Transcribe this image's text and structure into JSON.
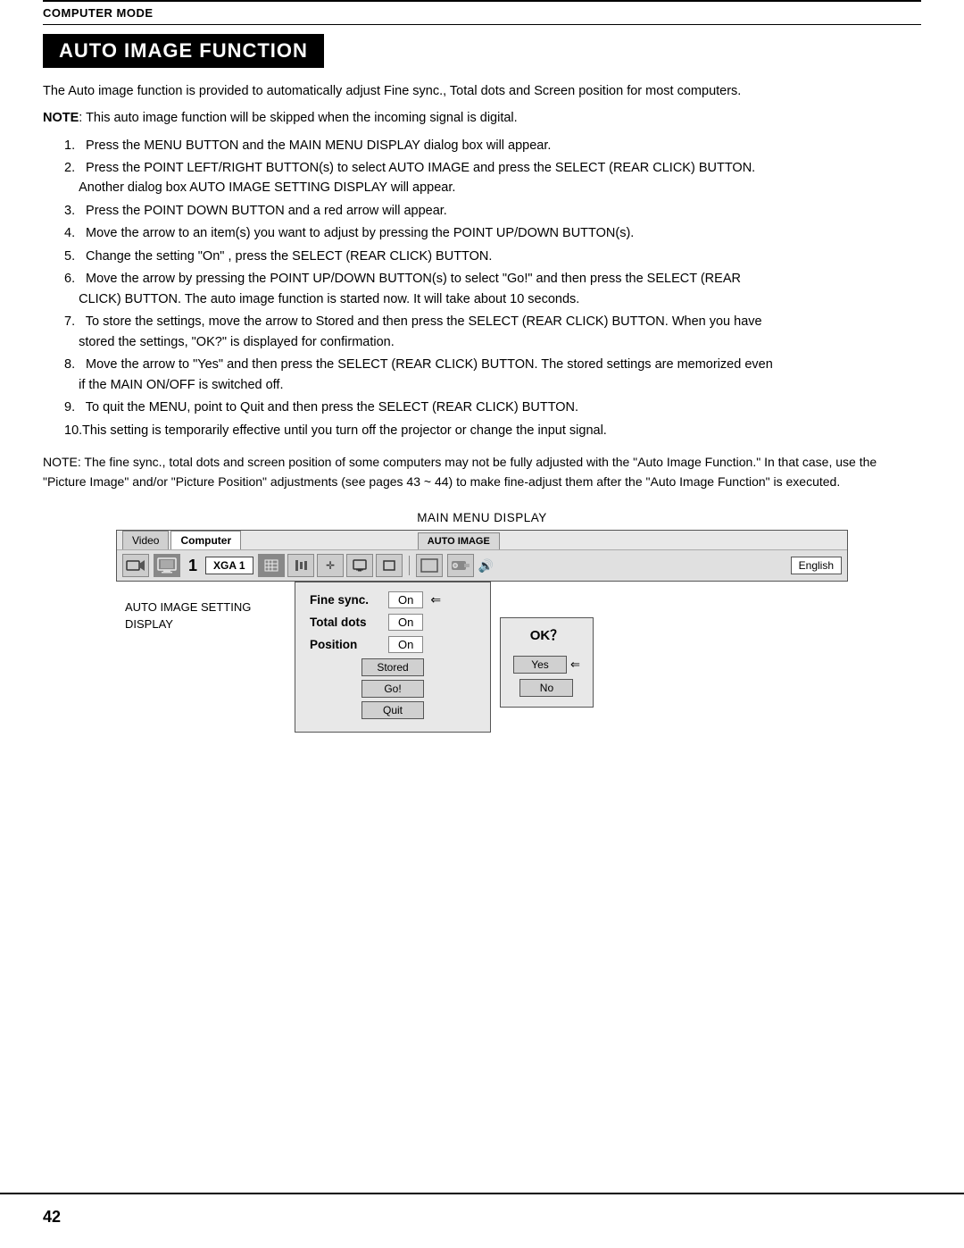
{
  "header": {
    "section": "COMPUTER MODE"
  },
  "title": "AUTO IMAGE FUNCTION",
  "intro": {
    "line1": "The Auto image function is provided to automatically adjust Fine sync., Total dots and Screen position for most computers.",
    "note_bold": "NOTE",
    "note": ": This auto image function will be skipped when the incoming signal is digital."
  },
  "steps": [
    {
      "num": "1.",
      "text": "Press the MENU BUTTON and the MAIN MENU DISPLAY dialog box will appear."
    },
    {
      "num": "2.",
      "text": "Press the POINT LEFT/RIGHT BUTTON(s) to select AUTO IMAGE and press the SELECT (REAR CLICK) BUTTON. Another dialog  box AUTO IMAGE SETTING DISPLAY will appear."
    },
    {
      "num": "3.",
      "text": "Press the POINT DOWN BUTTON and a red arrow will appear."
    },
    {
      "num": "4.",
      "text": "Move the arrow to an item(s) you want to adjust by pressing the POINT UP/DOWN BUTTON(s)."
    },
    {
      "num": "5.",
      "text": "Change the setting \"On\" , press the SELECT (REAR CLICK) BUTTON."
    },
    {
      "num": "6.",
      "text": "Move the arrow by pressing the POINT UP/DOWN BUTTON(s) to select \"Go!\" and then press the SELECT (REAR CLICK) BUTTON. The auto image function is started now. It will take about 10 seconds."
    },
    {
      "num": "7.",
      "text": "To store the settings, move the arrow to Stored and then press the SELECT (REAR CLICK) BUTTON.  When you have stored the settings, \"OK?\" is displayed for confirmation."
    },
    {
      "num": "8.",
      "text": "Move the arrow to \"Yes\" and then press the SELECT (REAR CLICK) BUTTON. The stored settings are memorized even if the MAIN ON/OFF is switched off."
    },
    {
      "num": "9.",
      "text": "To quit the MENU, point to Quit and then press the SELECT (REAR CLICK) BUTTON."
    },
    {
      "num": "10.",
      "text": "This setting is temporarily effective until you turn off the projector or change the input signal."
    }
  ],
  "note_bottom": "NOTE: The fine sync., total dots and screen position of some computers may not be fully adjusted with the \"Auto Image Function.\"  In that case, use the \"Picture Image\" and/or \"Picture Position\" adjustments (see pages 43 ~ 44) to make fine-adjust them after the \"Auto Image Function\" is executed.",
  "diagram": {
    "label": "MAIN MENU DISPLAY",
    "tabs": {
      "video": "Video",
      "computer": "Computer",
      "auto_image": "AUTO IMAGE"
    },
    "menu_items": {
      "xga": "XGA 1",
      "number": "1"
    },
    "setting_label": "AUTO IMAGE SETTING\nDISPLAY",
    "rows": [
      {
        "label": "Fine sync.",
        "value": "On"
      },
      {
        "label": "Total dots",
        "value": "On"
      },
      {
        "label": "Position",
        "value": "On"
      }
    ],
    "buttons": [
      "Stored",
      "Go!",
      "Quit"
    ],
    "ok_panel": {
      "title": "OK？",
      "buttons": [
        {
          "label": "Yes",
          "has_arrow": true
        },
        {
          "label": "No",
          "has_arrow": false
        }
      ]
    },
    "english": "English"
  },
  "page_number": "42"
}
